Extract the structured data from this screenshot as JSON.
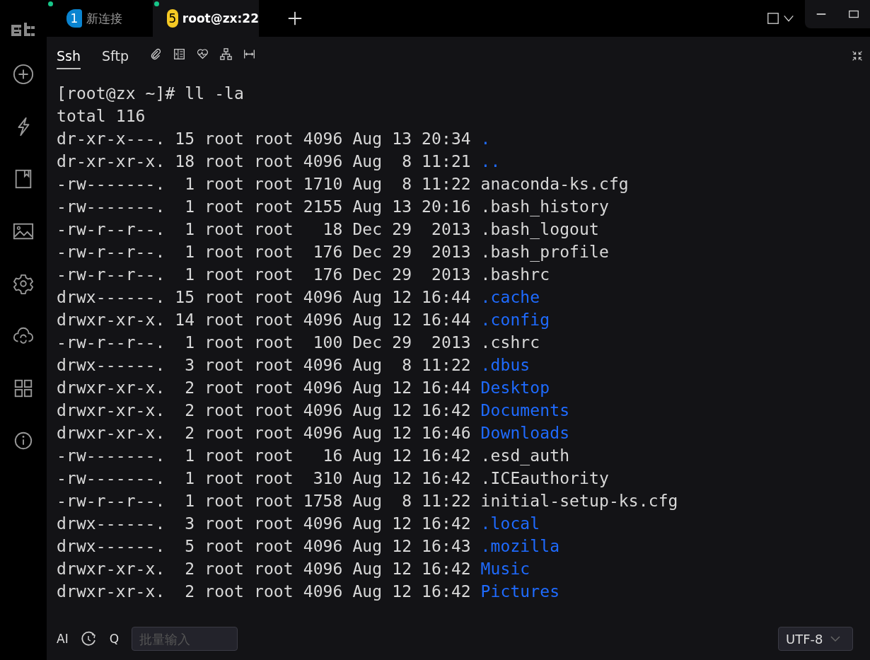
{
  "tabs": [
    {
      "badge": "1",
      "label": "新连接",
      "color": "#0a84d0",
      "selected": false,
      "connected": true
    },
    {
      "badge": "5",
      "label": "root@zx:22",
      "color": "#f5c924",
      "selected": true,
      "connected": true
    }
  ],
  "subtabs": [
    {
      "label": "Ssh",
      "selected": true
    },
    {
      "label": "Sftp",
      "selected": false
    }
  ],
  "terminal": {
    "prompt": "[root@zx ~]# ll -la",
    "total": "total 116",
    "lines": [
      {
        "info": "dr-xr-x---. 15 root root 4096 Aug 13 20:34",
        "name": ".",
        "kind": "dir"
      },
      {
        "info": "dr-xr-xr-x. 18 root root 4096 Aug  8 11:21",
        "name": "..",
        "kind": "dir"
      },
      {
        "info": "-rw-------.  1 root root 1710 Aug  8 11:22",
        "name": "anaconda-ks.cfg",
        "kind": "file"
      },
      {
        "info": "-rw-------.  1 root root 2155 Aug 13 20:16",
        "name": ".bash_history",
        "kind": "file"
      },
      {
        "info": "-rw-r--r--.  1 root root   18 Dec 29  2013",
        "name": ".bash_logout",
        "kind": "file"
      },
      {
        "info": "-rw-r--r--.  1 root root  176 Dec 29  2013",
        "name": ".bash_profile",
        "kind": "file"
      },
      {
        "info": "-rw-r--r--.  1 root root  176 Dec 29  2013",
        "name": ".bashrc",
        "kind": "file"
      },
      {
        "info": "drwx------. 15 root root 4096 Aug 12 16:44",
        "name": ".cache",
        "kind": "dir"
      },
      {
        "info": "drwxr-xr-x. 14 root root 4096 Aug 12 16:44",
        "name": ".config",
        "kind": "dir"
      },
      {
        "info": "-rw-r--r--.  1 root root  100 Dec 29  2013",
        "name": ".cshrc",
        "kind": "file"
      },
      {
        "info": "drwx------.  3 root root 4096 Aug  8 11:22",
        "name": ".dbus",
        "kind": "dir"
      },
      {
        "info": "drwxr-xr-x.  2 root root 4096 Aug 12 16:44",
        "name": "Desktop",
        "kind": "dir"
      },
      {
        "info": "drwxr-xr-x.  2 root root 4096 Aug 12 16:42",
        "name": "Documents",
        "kind": "dir"
      },
      {
        "info": "drwxr-xr-x.  2 root root 4096 Aug 12 16:46",
        "name": "Downloads",
        "kind": "dir"
      },
      {
        "info": "-rw-------.  1 root root   16 Aug 12 16:42",
        "name": ".esd_auth",
        "kind": "file"
      },
      {
        "info": "-rw-------.  1 root root  310 Aug 12 16:42",
        "name": ".ICEauthority",
        "kind": "file"
      },
      {
        "info": "-rw-r--r--.  1 root root 1758 Aug  8 11:22",
        "name": "initial-setup-ks.cfg",
        "kind": "file"
      },
      {
        "info": "drwx------.  3 root root 4096 Aug 12 16:42",
        "name": ".local",
        "kind": "dir"
      },
      {
        "info": "drwx------.  5 root root 4096 Aug 12 16:43",
        "name": ".mozilla",
        "kind": "dir"
      },
      {
        "info": "drwxr-xr-x.  2 root root 4096 Aug 12 16:42",
        "name": "Music",
        "kind": "dir"
      },
      {
        "info": "drwxr-xr-x.  2 root root 4096 Aug 12 16:42",
        "name": "Pictures",
        "kind": "dir"
      }
    ]
  },
  "bottom_bar": {
    "ai": "AI",
    "q": "Q",
    "batch_input": {
      "placeholder": "批量输入"
    },
    "encoding": "UTF-8"
  }
}
